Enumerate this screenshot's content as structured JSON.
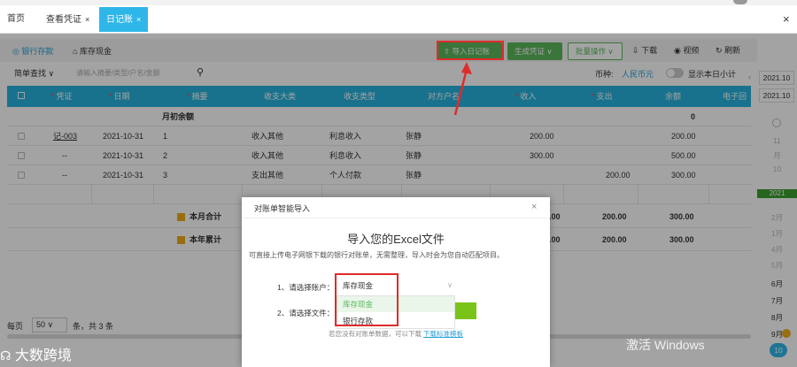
{
  "tabs": [
    {
      "label": "首页",
      "active": false
    },
    {
      "label": "查看凭证",
      "active": false
    },
    {
      "label": "日记账",
      "active": true
    }
  ],
  "tab_close": "×",
  "window_close": "×",
  "subtabs": [
    "银行存款",
    "库存现金"
  ],
  "toolbar": {
    "import_btn": "导入日记账",
    "gen_voucher": "生成凭证",
    "batch_ops": "批量操作",
    "download": "下载",
    "video": "视频",
    "refresh": "刷新"
  },
  "filter": {
    "mode": "简单查找",
    "placeholder": "请输入摘要/类型/户名/金额",
    "currency_label": "币种:",
    "currency_value": "人民币元",
    "show_daily_subtotal": "显示本日小计"
  },
  "table": {
    "headers": [
      "凭证",
      "日期",
      "摘要",
      "收支大类",
      "收支类型",
      "对方户名",
      "收入",
      "支出",
      "余额",
      "电子回单"
    ],
    "opening_label": "月初余额",
    "opening_balance": "0",
    "rows": [
      {
        "voucher": "记-003",
        "date": "2021-10-31",
        "summary": "1",
        "category": "收入其他",
        "type": "利息收入",
        "counterparty": "张静",
        "income": "200.00",
        "expense": "",
        "balance": "200.00"
      },
      {
        "voucher": "--",
        "date": "2021-10-31",
        "summary": "2",
        "category": "收入其他",
        "type": "利息收入",
        "counterparty": "张静",
        "income": "300.00",
        "expense": "",
        "balance": "500.00"
      },
      {
        "voucher": "--",
        "date": "2021-10-31",
        "summary": "3",
        "category": "支出其他",
        "type": "个人付款",
        "counterparty": "张静",
        "income": "",
        "expense": "200.00",
        "balance": "300.00"
      }
    ],
    "month_total_label": "本月合计",
    "year_total_label": "本年累计",
    "total_income_tail": ".00",
    "total_expense": "200.00",
    "total_balance": "300.00"
  },
  "pager": {
    "per_page_label": "每页",
    "per_page": "50",
    "summary": "条，共 3 条"
  },
  "datebar": {
    "years": [
      "2021.10",
      "2021.10"
    ],
    "months": [
      "11",
      "月",
      "10",
      "2月",
      "1月",
      "4月",
      "5月",
      "6月",
      "7月",
      "8月",
      "9月",
      "10"
    ],
    "current": "2021",
    "flag": "10"
  },
  "modal": {
    "title": "对账单智能导入",
    "close": "×",
    "heading": "导入您的Excel文件",
    "description": "可直接上传电子网银下载的银行对账单，无需整理，导入时会为您自动匹配项目。",
    "account_label": "1、请选择账户：",
    "account_value": "库存现金",
    "file_label": "2、请选择文件：",
    "dropdown_options": [
      "库存现金",
      "银行存款"
    ],
    "footer_text": "若您没有对账单数据，可以下载",
    "footer_link": "下载标准模板"
  },
  "watermark": "大数跨境",
  "activate": "激活 Windows",
  "colors": {
    "accent": "#2fb6e8",
    "green": "#5cb85c",
    "red": "#e02b2b"
  }
}
